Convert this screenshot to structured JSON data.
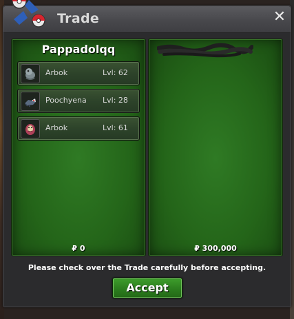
{
  "window": {
    "title": "Trade",
    "close_glyph": "✕"
  },
  "left_panel": {
    "trainer_name": "Pappadolqq",
    "pokemon": [
      {
        "name": "Arbok",
        "level": "Lvl: 62",
        "icon": "arbok-shiny-icon"
      },
      {
        "name": "Poochyena",
        "level": "Lvl: 28",
        "icon": "poochyena-icon"
      },
      {
        "name": "Arbok",
        "level": "Lvl: 61",
        "icon": "arbok-icon"
      }
    ],
    "money": "₽ 0"
  },
  "right_panel": {
    "trainer_name_redacted": true,
    "pokemon": [],
    "money": "₽ 300,000"
  },
  "notice": "Please check over the Trade carefully before accepting.",
  "accept_label": "Accept",
  "colors": {
    "panel_green": "#2a6e1f",
    "button_green": "#2c7d1e",
    "titlebar": "#4a4a4e"
  }
}
